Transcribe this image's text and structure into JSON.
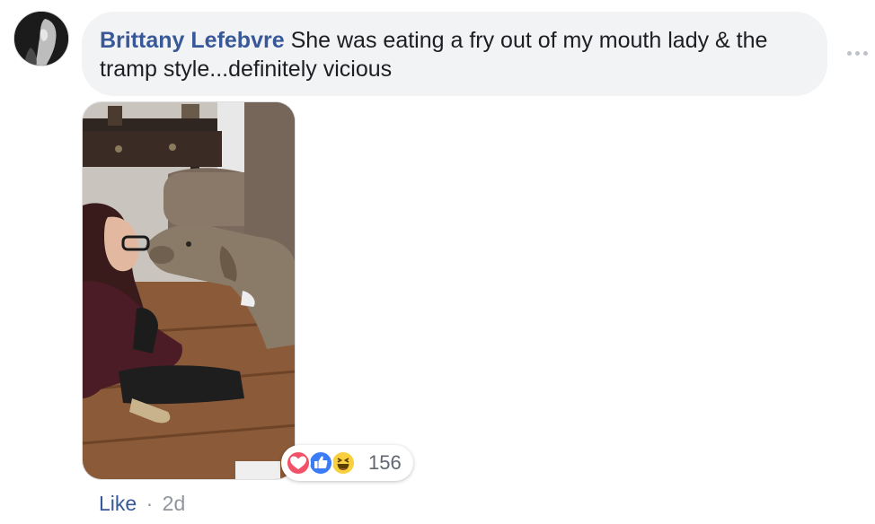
{
  "comment": {
    "author": "Brittany Lefebvre",
    "text": "She was eating a fry out of my mouth lady & the tramp style...definitely vicious"
  },
  "reactions": {
    "types": [
      "love-icon",
      "like-icon",
      "haha-icon"
    ],
    "count": "156",
    "colors": {
      "love": "#f25268",
      "like": "#3b7bf6",
      "haha": "#f8cf3c"
    }
  },
  "actions": {
    "like_label": "Like",
    "separator": "·",
    "timestamp": "2d"
  },
  "colors": {
    "author_link": "#385898",
    "bubble_bg": "#f2f3f5",
    "meta_text": "#90949c"
  }
}
